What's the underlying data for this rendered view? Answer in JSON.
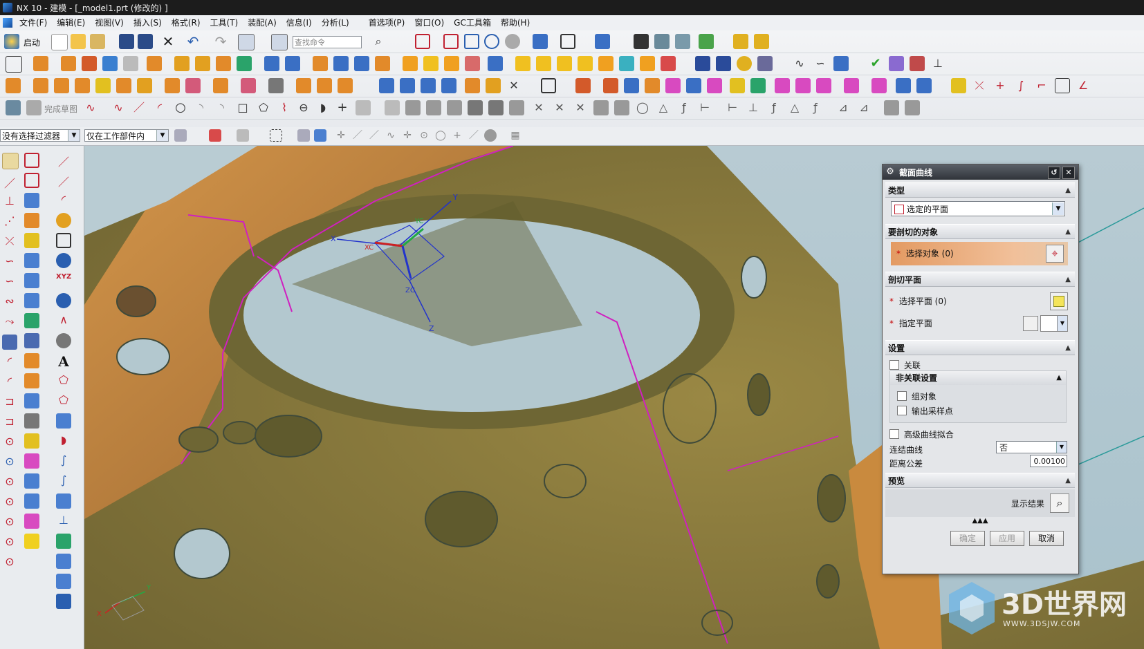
{
  "window": {
    "title": "NX 10 - 建模 - [_model1.prt  (修改的) ]"
  },
  "menu": {
    "items": [
      "文件(F)",
      "编辑(E)",
      "视图(V)",
      "插入(S)",
      "格式(R)",
      "工具(T)",
      "装配(A)",
      "信息(I)",
      "分析(L)",
      "首选项(P)",
      "窗口(O)",
      "GC工具箱",
      "帮助(H)"
    ]
  },
  "toolbar": {
    "start_label": "启动",
    "search_placeholder": "查找命令",
    "sketch_finish_label": "完成草图"
  },
  "filter_bar": {
    "selection_filter": "没有选择过滤器",
    "scope": "仅在工作部件内"
  },
  "viewport": {
    "axis_labels": {
      "x": "X",
      "y": "Y",
      "z": "Z",
      "xc": "XC",
      "yc": "YC",
      "zc": "ZC"
    },
    "triad": {
      "x": "X",
      "y": "Y"
    }
  },
  "dialog": {
    "title": "截面曲线",
    "sections": {
      "type": {
        "header": "类型",
        "value": "选定的平面"
      },
      "objects": {
        "header": "要剖切的对象",
        "select_label": "选择对象 (0)"
      },
      "plane": {
        "header": "剖切平面",
        "select_plane_label": "选择平面 (0)",
        "specify_plane_label": "指定平面"
      },
      "settings": {
        "header": "设置",
        "associative": "关联",
        "non_assoc_header": "非关联设置",
        "group_objects": "组对象",
        "output_sample_points": "输出采样点",
        "advanced_fit": "高级曲线拟合",
        "join_curves_label": "连结曲线",
        "join_curves_value": "否",
        "distance_tol_label": "距离公差",
        "distance_tol_value": "0.00100"
      },
      "preview": {
        "header": "预览",
        "show_result": "显示结果"
      }
    },
    "buttons": {
      "ok": "确定",
      "apply": "应用",
      "cancel": "取消"
    }
  },
  "watermark": {
    "brand": "3D世界网",
    "url": "WWW.3DSJW.COM"
  },
  "colors": {
    "model_bronze": "#8b7a3f",
    "model_orange": "#c98a3e",
    "section_curve": "#d020c0",
    "viewport_bg": "#abc3cc",
    "accent_orange": "#e8a06a"
  }
}
